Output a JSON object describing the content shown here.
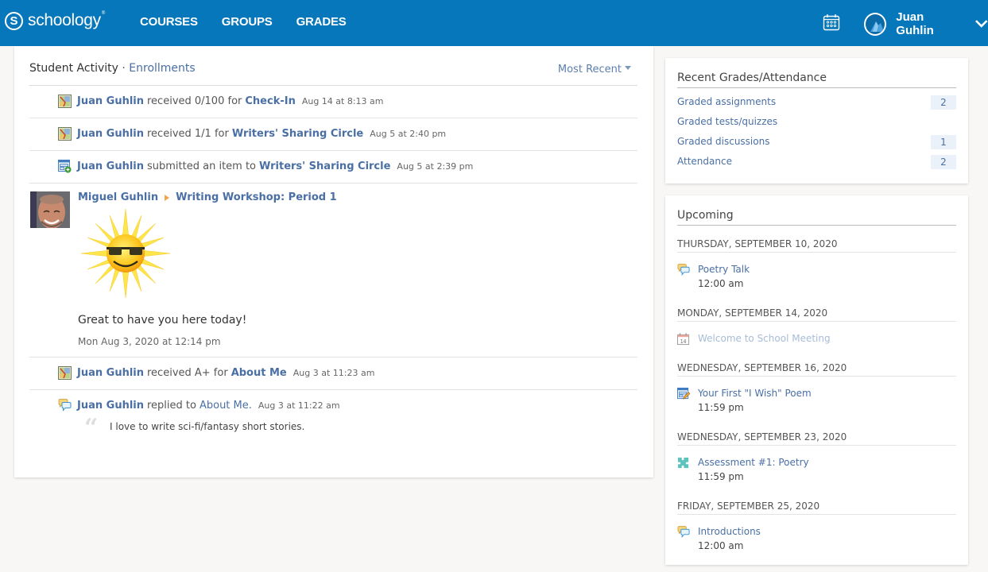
{
  "header": {
    "logo_letter": "S",
    "logo_text": "schoology",
    "logo_tm": "®",
    "nav": [
      "COURSES",
      "GROUPS",
      "GRADES"
    ],
    "user_name": "Juan Guhlin",
    "brand_color": "#0677ba"
  },
  "activity": {
    "title": "Student Activity",
    "separator": "·",
    "enrollments_link": "Enrollments",
    "sort_label": "Most Recent",
    "rows": [
      {
        "icon": "grade-icon",
        "who": "Juan Guhlin",
        "verb": "received 0/100 for",
        "target": "Check-In",
        "time": "Aug 14 at 8:13 am"
      },
      {
        "icon": "grade-icon",
        "who": "Juan Guhlin",
        "verb": "received 1/1 for",
        "target": "Writers' Sharing Circle",
        "time": "Aug 5 at 2:40 pm"
      },
      {
        "icon": "submission-icon",
        "who": "Juan Guhlin",
        "verb": "submitted an item to",
        "target": "Writers' Sharing Circle",
        "time": "Aug 5 at 2:39 pm"
      }
    ],
    "post": {
      "author": "Miguel Guhlin",
      "course": "Writing Workshop: Period 1",
      "image": "smiling-sun-with-sunglasses",
      "text": "Great to have you here today!",
      "time": "Mon Aug 3, 2020 at 12:14 pm"
    },
    "rows2": [
      {
        "icon": "grade-icon",
        "who": "Juan Guhlin",
        "verb": "received A+ for",
        "target": "About Me",
        "time": "Aug 3 at 11:23 am"
      },
      {
        "icon": "discussion-icon",
        "who": "Juan Guhlin",
        "verb": "replied to",
        "target": "About Me.",
        "time": "Aug 3 at 11:22 am",
        "quote": "I love to write sci-fi/fantasy short stories."
      }
    ]
  },
  "grades": {
    "title": "Recent Grades/Attendance",
    "items": [
      {
        "label": "Graded assignments",
        "count": "2"
      },
      {
        "label": "Graded tests/quizzes",
        "count": null
      },
      {
        "label": "Graded discussions",
        "count": "1"
      },
      {
        "label": "Attendance",
        "count": "2"
      }
    ]
  },
  "upcoming": {
    "title": "Upcoming",
    "days": [
      {
        "date": "THURSDAY, SEPTEMBER 10, 2020",
        "items": [
          {
            "icon": "discussion-icon",
            "title": "Poetry Talk",
            "time": "12:00 am"
          }
        ]
      },
      {
        "date": "MONDAY, SEPTEMBER 14, 2020",
        "items": [
          {
            "icon": "calendar-event-icon",
            "icon_day": "14",
            "title": "Welcome to School Meeting",
            "time": null
          }
        ]
      },
      {
        "date": "WEDNESDAY, SEPTEMBER 16, 2020",
        "items": [
          {
            "icon": "assignment-icon",
            "title": "Your First \"I Wish\" Poem",
            "time": "11:59 pm"
          }
        ]
      },
      {
        "date": "WEDNESDAY, SEPTEMBER 23, 2020",
        "items": [
          {
            "icon": "assessment-icon",
            "title": "Assessment #1: Poetry",
            "time": "11:59 pm"
          }
        ]
      },
      {
        "date": "FRIDAY, SEPTEMBER 25, 2020",
        "items": [
          {
            "icon": "discussion-icon",
            "title": "Introductions",
            "time": "12:00 am"
          }
        ]
      }
    ]
  }
}
